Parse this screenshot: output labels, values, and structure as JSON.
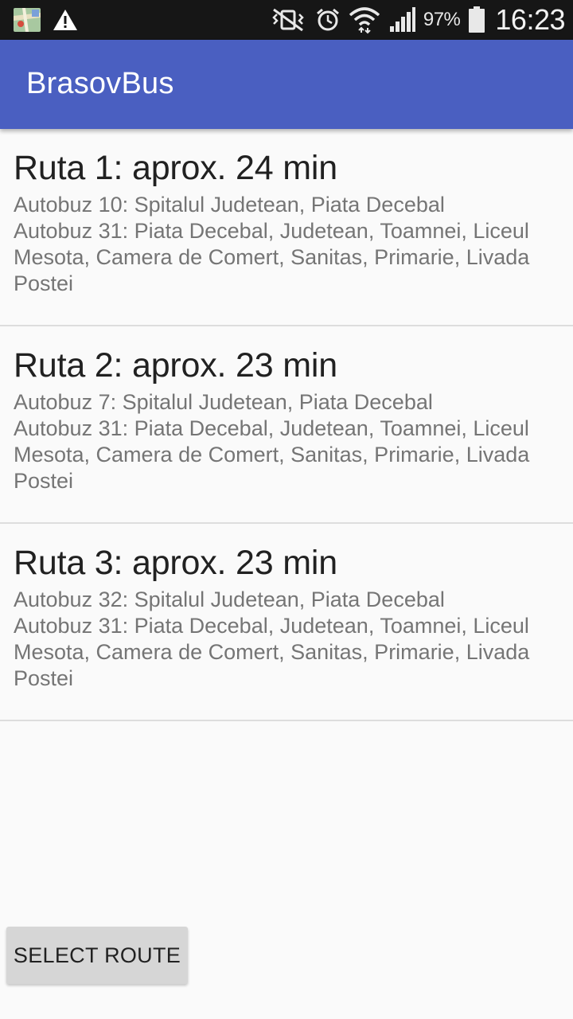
{
  "status_bar": {
    "icons_left": [
      "maps-notification-icon",
      "warning-icon"
    ],
    "icons_right": [
      "vibrate-mute-icon",
      "alarm-icon",
      "wifi-icon",
      "signal-icon",
      "battery-icon"
    ],
    "battery_percent": "97%",
    "time": "16:23"
  },
  "app_bar": {
    "title": "BrasovBus",
    "color": "#4a5fc1"
  },
  "routes": [
    {
      "title": "Ruta 1: aprox. 24 min",
      "lines": [
        "Autobuz 10: Spitalul Judetean, Piata Decebal",
        "Autobuz 31: Piata Decebal, Judetean, Toamnei, Liceul Mesota, Camera de Comert, Sanitas, Primarie, Livada Postei"
      ]
    },
    {
      "title": "Ruta 2: aprox. 23 min",
      "lines": [
        "Autobuz 7: Spitalul Judetean, Piata Decebal",
        "Autobuz 31: Piata Decebal, Judetean, Toamnei, Liceul Mesota, Camera de Comert, Sanitas, Primarie, Livada Postei"
      ]
    },
    {
      "title": "Ruta 3: aprox. 23 min",
      "lines": [
        "Autobuz 32: Spitalul Judetean, Piata Decebal",
        "Autobuz 31: Piata Decebal, Judetean, Toamnei, Liceul Mesota, Camera de Comert, Sanitas, Primarie, Livada Postei"
      ]
    }
  ],
  "actions": {
    "select_route_label": "SELECT ROUTE"
  }
}
